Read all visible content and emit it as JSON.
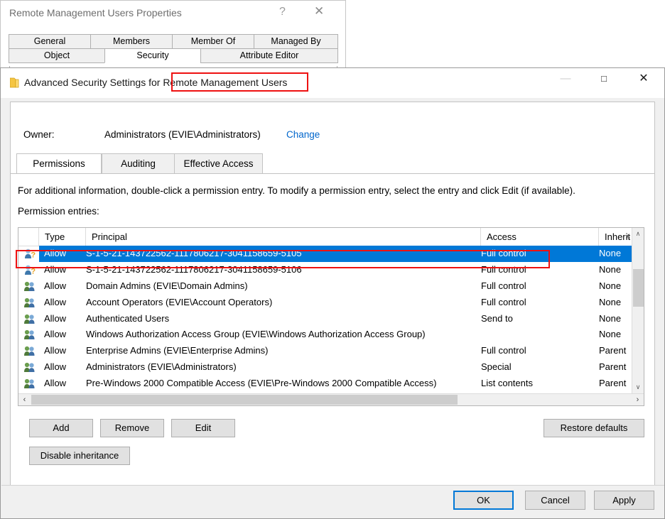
{
  "properties_dialog": {
    "title": "Remote Management Users Properties",
    "help_icon": "?",
    "close_icon": "✕",
    "tabs_row1": [
      "General",
      "Members",
      "Member Of",
      "Managed By"
    ],
    "tabs_row2": [
      "Object",
      "Security",
      "Attribute Editor"
    ],
    "active_tab": "Security"
  },
  "advanced_window": {
    "title": "Advanced Security Settings for Remote Management Users",
    "folder_icon": "folder-icon",
    "minimize_icon": "—",
    "maximize_icon": "□",
    "close_icon": "✕",
    "owner": {
      "label": "Owner:",
      "value": "Administrators (EVIE\\Administrators)",
      "change_link": "Change"
    },
    "tabs": [
      "Permissions",
      "Auditing",
      "Effective Access"
    ],
    "active_tab": "Permissions",
    "info_text": "For additional information, double-click a permission entry. To modify a permission entry, select the entry and click Edit (if available).",
    "entries_label": "Permission entries:",
    "columns": [
      "",
      "Type",
      "Principal",
      "Access",
      "Inherit"
    ],
    "sort_indicator": "∧",
    "rows": [
      {
        "icon": "user-unknown-icon",
        "type": "Allow",
        "principal": "S-1-5-21-143722562-1117806217-3041158659-5105",
        "access": "Full control",
        "inherited_from": "None",
        "selected": true
      },
      {
        "icon": "user-unknown-icon",
        "type": "Allow",
        "principal": "S-1-5-21-143722562-1117806217-3041158659-5106",
        "access": "Full control",
        "inherited_from": "None",
        "selected": false
      },
      {
        "icon": "group-icon",
        "type": "Allow",
        "principal": "Domain Admins (EVIE\\Domain Admins)",
        "access": "Full control",
        "inherited_from": "None",
        "selected": false
      },
      {
        "icon": "group-icon",
        "type": "Allow",
        "principal": "Account Operators (EVIE\\Account Operators)",
        "access": "Full control",
        "inherited_from": "None",
        "selected": false
      },
      {
        "icon": "group-icon",
        "type": "Allow",
        "principal": "Authenticated Users",
        "access": "Send to",
        "inherited_from": "None",
        "selected": false
      },
      {
        "icon": "group-icon",
        "type": "Allow",
        "principal": "Windows Authorization Access Group (EVIE\\Windows Authorization Access Group)",
        "access": "",
        "inherited_from": "None",
        "selected": false
      },
      {
        "icon": "group-icon",
        "type": "Allow",
        "principal": "Enterprise Admins (EVIE\\Enterprise Admins)",
        "access": "Full control",
        "inherited_from": "Parent",
        "selected": false
      },
      {
        "icon": "group-icon",
        "type": "Allow",
        "principal": "Administrators (EVIE\\Administrators)",
        "access": "Special",
        "inherited_from": "Parent",
        "selected": false
      },
      {
        "icon": "group-icon",
        "type": "Allow",
        "principal": "Pre-Windows 2000 Compatible Access (EVIE\\Pre-Windows 2000 Compatible Access)",
        "access": "List contents",
        "inherited_from": "Parent",
        "selected": false
      }
    ],
    "scrollbars": {
      "up_arrow": "∧",
      "down_arrow": "∨",
      "left_arrow": "‹",
      "right_arrow": "›"
    },
    "buttons": {
      "add": "Add",
      "remove": "Remove",
      "edit": "Edit",
      "restore_defaults": "Restore defaults",
      "disable_inheritance": "Disable inheritance"
    },
    "footer_buttons": {
      "ok": "OK",
      "cancel": "Cancel",
      "apply": "Apply"
    }
  },
  "annotations": {
    "accent_color": "#ee1111",
    "title_highlight": "Remote Management Users",
    "row_highlight": "selected permission entry row"
  },
  "colors": {
    "selection_blue": "#0078d7",
    "link_blue": "#0066cc",
    "window_bg": "#f0f0f0",
    "annotation_red": "#ee1111"
  }
}
